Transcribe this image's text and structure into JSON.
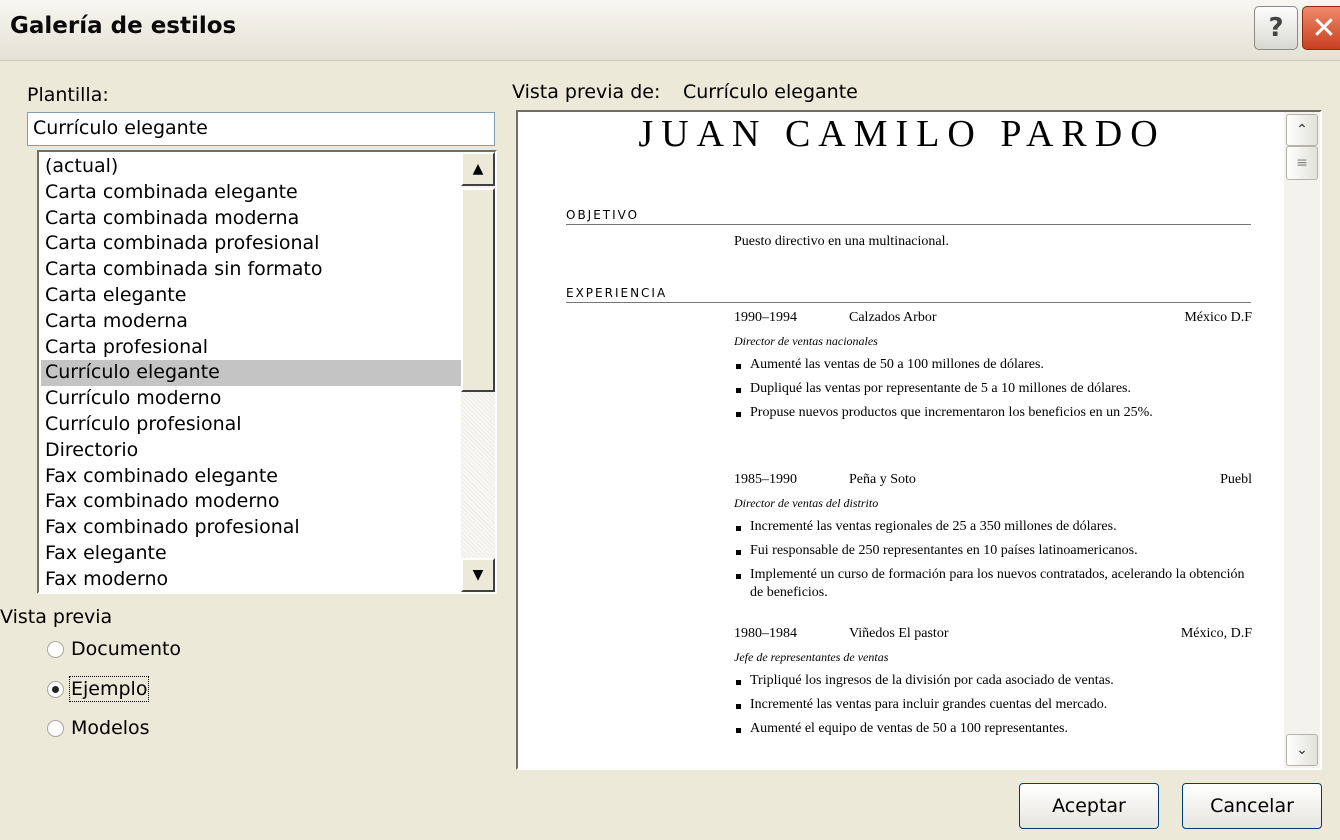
{
  "window": {
    "title": "Galería de estilos",
    "help_icon": "?",
    "close_icon": "✕"
  },
  "template_label": "Plantilla:",
  "template_value": "Currículo elegante",
  "templates": [
    "(actual)",
    "Carta combinada elegante",
    "Carta combinada moderna",
    "Carta combinada profesional",
    "Carta combinada sin formato",
    "Carta elegante",
    "Carta moderna",
    "Carta profesional",
    "Currículo elegante",
    "Currículo moderno",
    "Currículo profesional",
    "Directorio",
    "Fax combinado elegante",
    "Fax combinado moderno",
    "Fax combinado profesional",
    "Fax elegante",
    "Fax moderno"
  ],
  "selected_template_index": 8,
  "preview_options": {
    "label": "Vista previa",
    "options": [
      "Documento",
      "Ejemplo",
      "Modelos"
    ],
    "selected": "Ejemplo"
  },
  "preview": {
    "label": "Vista previa de:",
    "name": "Currículo elegante",
    "resume": {
      "name": "JUAN CAMILO PARDO",
      "objective_heading": "OBJETIVO",
      "objective": "Puesto directivo en una multinacional.",
      "experience_heading": "EXPERIENCIA",
      "jobs": [
        {
          "dates": "1990–1994",
          "company": "Calzados Arbor",
          "location": "México D.F",
          "role": "Director de ventas nacionales",
          "bullets": [
            "Aumenté las ventas de 50 a 100 millones de dólares.",
            "Dupliqué las ventas por representante de 5 a 10 millones de dólares.",
            "Propuse nuevos productos que incrementaron los beneficios en un 25%."
          ]
        },
        {
          "dates": "1985–1990",
          "company": "Peña y Soto",
          "location": "Puebl",
          "role": "Director de ventas del distrito",
          "bullets": [
            "Incrementé las ventas regionales de 25 a 350 millones de dólares.",
            "Fui responsable de 250 representantes en 10 países latinoamericanos.",
            "Implementé un curso de formación para los nuevos contratados, acelerando la obtención de beneficios."
          ]
        },
        {
          "dates": "1980–1984",
          "company": "Viñedos El pastor",
          "location": "México, D.F",
          "role": "Jefe de representantes de ventas",
          "bullets": [
            "Tripliqué los ingresos de la división por cada asociado de ventas.",
            "Incrementé las ventas para incluir grandes cuentas del mercado.",
            "Aumenté el equipo de ventas de 50 a 100 representantes."
          ]
        }
      ]
    }
  },
  "buttons": {
    "ok": "Aceptar",
    "cancel": "Cancelar"
  }
}
